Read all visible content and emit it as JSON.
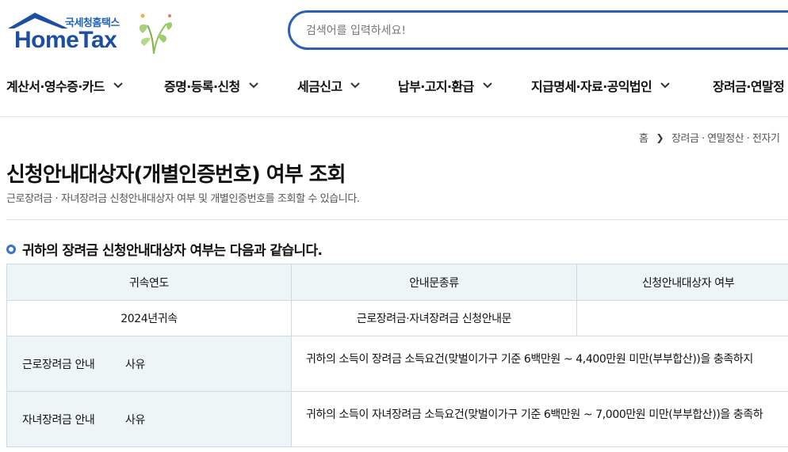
{
  "brand": {
    "sub": "국세청홈택스",
    "name": "HomeTax",
    "colors": {
      "primary": "#1c4fa1",
      "accent": "#2f5fb3"
    }
  },
  "search": {
    "placeholder": "검색어를 입력하세요!"
  },
  "nav": [
    {
      "label": "계산서·영수증·카드"
    },
    {
      "label": "증명·등록·신청"
    },
    {
      "label": "세금신고"
    },
    {
      "label": "납부·고지·환급"
    },
    {
      "label": "지급명세·자료·공익법인"
    },
    {
      "label": "장려금·연말정"
    }
  ],
  "breadcrumb": {
    "home": "홈",
    "current": "장려금 · 연말정산 · 전자기"
  },
  "page": {
    "title": "신청안내대상자(개별인증번호) 여부 조회",
    "description": "근로장려금 · 자녀장려금 신청안내대상자 여부 및 개별인증번호를 조회할 수 있습니다.",
    "section_title": "귀하의 장려금 신청안내대상자 여부는 다음과 같습니다."
  },
  "table": {
    "headers": [
      "귀속연도",
      "안내문종류",
      "신청안내대상자 여부"
    ],
    "row": {
      "year": "2024년귀속",
      "notice_type": "근로장려금·자녀장려금 신청안내문",
      "eligible": ""
    },
    "reasons": [
      {
        "label": "근로장려금 안내",
        "sub_label": "사유",
        "text": "귀하의 소득이 장려금 소득요건(맞벌이가구 기준 6백만원 ~ 4,400만원 미만(부부합산))을 충족하지"
      },
      {
        "label": "자녀장려금 안내",
        "sub_label": "사유",
        "text": "귀하의 소득이 자녀장려금 소득요건(맞벌이가구 기준 6백만원 ~ 7,000만원 미만(부부합산))을 충족하"
      }
    ]
  }
}
